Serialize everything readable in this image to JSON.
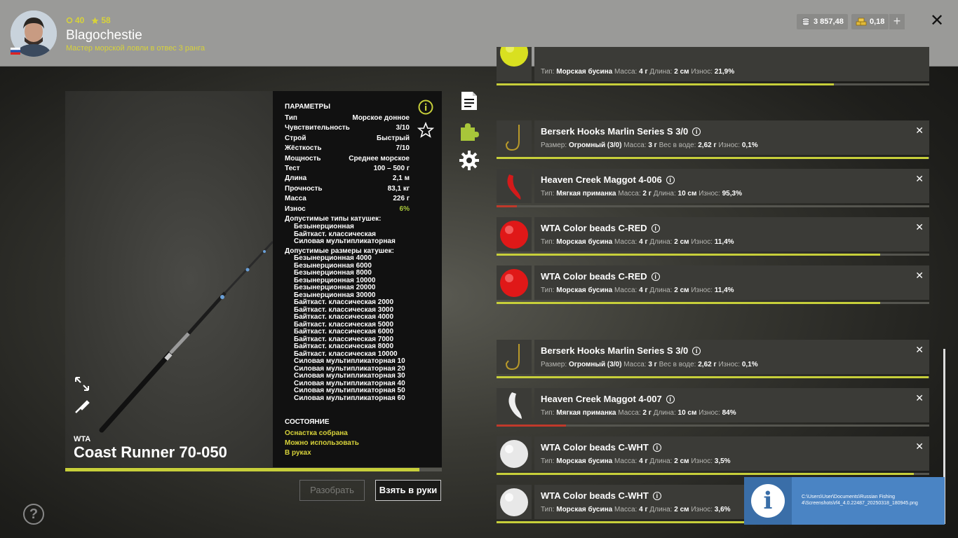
{
  "header": {
    "level": "40",
    "rating": "58",
    "username": "Blagochestie",
    "subtitle": "Мастер морской ловли в отвес 3 ранга",
    "silver": "3 857,48",
    "gold": "0,18",
    "plus_label": "+",
    "close_label": "✕"
  },
  "rod": {
    "brand": "WTA",
    "name": "Coast Runner 70-050",
    "condition_fraction": 0.94
  },
  "params": {
    "title": "ПАРАМЕТРЫ",
    "rows": [
      {
        "label": "Тип",
        "value": "Морское донное"
      },
      {
        "label": "Чувствительность",
        "value": "3/10"
      },
      {
        "label": "Строй",
        "value": "Быстрый"
      },
      {
        "label": "Жёсткость",
        "value": "7/10"
      },
      {
        "label": "Мощность",
        "value": "Среднее морское"
      },
      {
        "label": "Тест",
        "value": "100 – 500 г"
      },
      {
        "label": "Длина",
        "value": "2,1 м"
      },
      {
        "label": "Прочность",
        "value": "83,1 кг"
      },
      {
        "label": "Масса",
        "value": "226 г"
      },
      {
        "label": "Износ",
        "value": "6%"
      }
    ],
    "reel_types_title": "Допустимые типы катушек:",
    "reel_types": [
      "Безынерционная",
      "Байткаст. классическая",
      "Силовая мультипликаторная"
    ],
    "reel_sizes_title": "Допустимые размеры катушек:",
    "reel_sizes": [
      "Безынерционная 4000",
      "Безынерционная 6000",
      "Безынерционная 8000",
      "Безынерционная 10000",
      "Безынерционная 20000",
      "Безынерционная 30000",
      "Байткаст. классическая 2000",
      "Байткаст. классическая 3000",
      "Байткаст. классическая 4000",
      "Байткаст. классическая 5000",
      "Байткаст. классическая 6000",
      "Байткаст. классическая 7000",
      "Байткаст. классическая 8000",
      "Байткаст. классическая 10000",
      "Силовая мультипликаторная 10",
      "Силовая мультипликаторная 20",
      "Силовая мультипликаторная 30",
      "Силовая мультипликаторная 40",
      "Силовая мультипликаторная 50",
      "Силовая мультипликаторная 60"
    ],
    "state_title": "СОСТОЯНИЕ",
    "states": [
      "Оснастка собрана",
      "Можно использовать",
      "В руках"
    ]
  },
  "buttons": {
    "disassemble": "Разобрать",
    "take": "Взять в руки"
  },
  "help_label": "?",
  "items": [
    {
      "name": "",
      "props": [
        {
          "k": "Тип:",
          "v": "Морская бусина"
        },
        {
          "k": "Масса:",
          "v": "4 г"
        },
        {
          "k": "Длина:",
          "v": "2 см"
        }
      ],
      "wear_label": "Износ:",
      "wear": "21,9%",
      "wear_state": "ok",
      "condition": 0.78,
      "bar_color": "#c7cf3a",
      "thumb": "bead-yellow",
      "closable": false,
      "partial": true
    },
    {
      "name": "Berserk Hooks Marlin Series S 3/0",
      "props": [
        {
          "k": "Размер:",
          "v": "Огромный (3/0)"
        },
        {
          "k": "Масса:",
          "v": "3 г"
        },
        {
          "k": "Вес в воде:",
          "v": "2,62 г"
        }
      ],
      "wear_label": "Износ:",
      "wear": "0,1%",
      "wear_state": "ok",
      "condition": 0.999,
      "bar_color": "#c7cf3a",
      "thumb": "hook",
      "closable": true
    },
    {
      "name": "Heaven Creek Maggot 4-006",
      "props": [
        {
          "k": "Тип:",
          "v": "Мягкая приманка"
        },
        {
          "k": "Масса:",
          "v": "2 г"
        },
        {
          "k": "Длина:",
          "v": "10 см"
        }
      ],
      "wear_label": "Износ:",
      "wear": "95,3%",
      "wear_state": "bad",
      "condition": 0.047,
      "bar_color": "#c0392b",
      "thumb": "maggot-red",
      "closable": true
    },
    {
      "name": "WTA Color beads C-RED",
      "props": [
        {
          "k": "Тип:",
          "v": "Морская бусина"
        },
        {
          "k": "Масса:",
          "v": "4 г"
        },
        {
          "k": "Длина:",
          "v": "2 см"
        }
      ],
      "wear_label": "Износ:",
      "wear": "11,4%",
      "wear_state": "ok",
      "condition": 0.886,
      "bar_color": "#c7cf3a",
      "thumb": "bead-red",
      "closable": true
    },
    {
      "name": "WTA Color beads C-RED",
      "props": [
        {
          "k": "Тип:",
          "v": "Морская бусина"
        },
        {
          "k": "Масса:",
          "v": "4 г"
        },
        {
          "k": "Длина:",
          "v": "2 см"
        }
      ],
      "wear_label": "Износ:",
      "wear": "11,4%",
      "wear_state": "ok",
      "condition": 0.886,
      "bar_color": "#c7cf3a",
      "thumb": "bead-red",
      "closable": true
    },
    {
      "name": "Berserk Hooks Marlin Series S 3/0",
      "props": [
        {
          "k": "Размер:",
          "v": "Огромный (3/0)"
        },
        {
          "k": "Масса:",
          "v": "3 г"
        },
        {
          "k": "Вес в воде:",
          "v": "2,62 г"
        }
      ],
      "wear_label": "Износ:",
      "wear": "0,1%",
      "wear_state": "ok",
      "condition": 0.999,
      "bar_color": "#c7cf3a",
      "thumb": "hook",
      "closable": true
    },
    {
      "name": "Heaven Creek Maggot 4-007",
      "props": [
        {
          "k": "Тип:",
          "v": "Мягкая приманка"
        },
        {
          "k": "Масса:",
          "v": "2 г"
        },
        {
          "k": "Длина:",
          "v": "10 см"
        }
      ],
      "wear_label": "Износ:",
      "wear": "84%",
      "wear_state": "bad",
      "condition": 0.16,
      "bar_color": "#c0392b",
      "thumb": "maggot-white",
      "closable": true
    },
    {
      "name": "WTA Color beads C-WHT",
      "props": [
        {
          "k": "Тип:",
          "v": "Морская бусина"
        },
        {
          "k": "Масса:",
          "v": "4 г"
        },
        {
          "k": "Длина:",
          "v": "2 см"
        }
      ],
      "wear_label": "Износ:",
      "wear": "3,5%",
      "wear_state": "ok",
      "condition": 0.965,
      "bar_color": "#c7cf3a",
      "thumb": "bead-white",
      "closable": true
    },
    {
      "name": "WTA Color beads C-WHT",
      "props": [
        {
          "k": "Тип:",
          "v": "Морская бусина"
        },
        {
          "k": "Масса:",
          "v": "4 г"
        },
        {
          "k": "Длина:",
          "v": "2 см"
        }
      ],
      "wear_label": "Износ:",
      "wear": "3,6%",
      "wear_state": "ok",
      "condition": 0.964,
      "bar_color": "#c7cf3a",
      "thumb": "bead-white",
      "closable": true
    }
  ],
  "notification": {
    "path": "C:\\Users\\User\\Documents\\Russian Fishing 4\\Screenshots\\rf4_4.0.22487_20250318_180945.png"
  }
}
